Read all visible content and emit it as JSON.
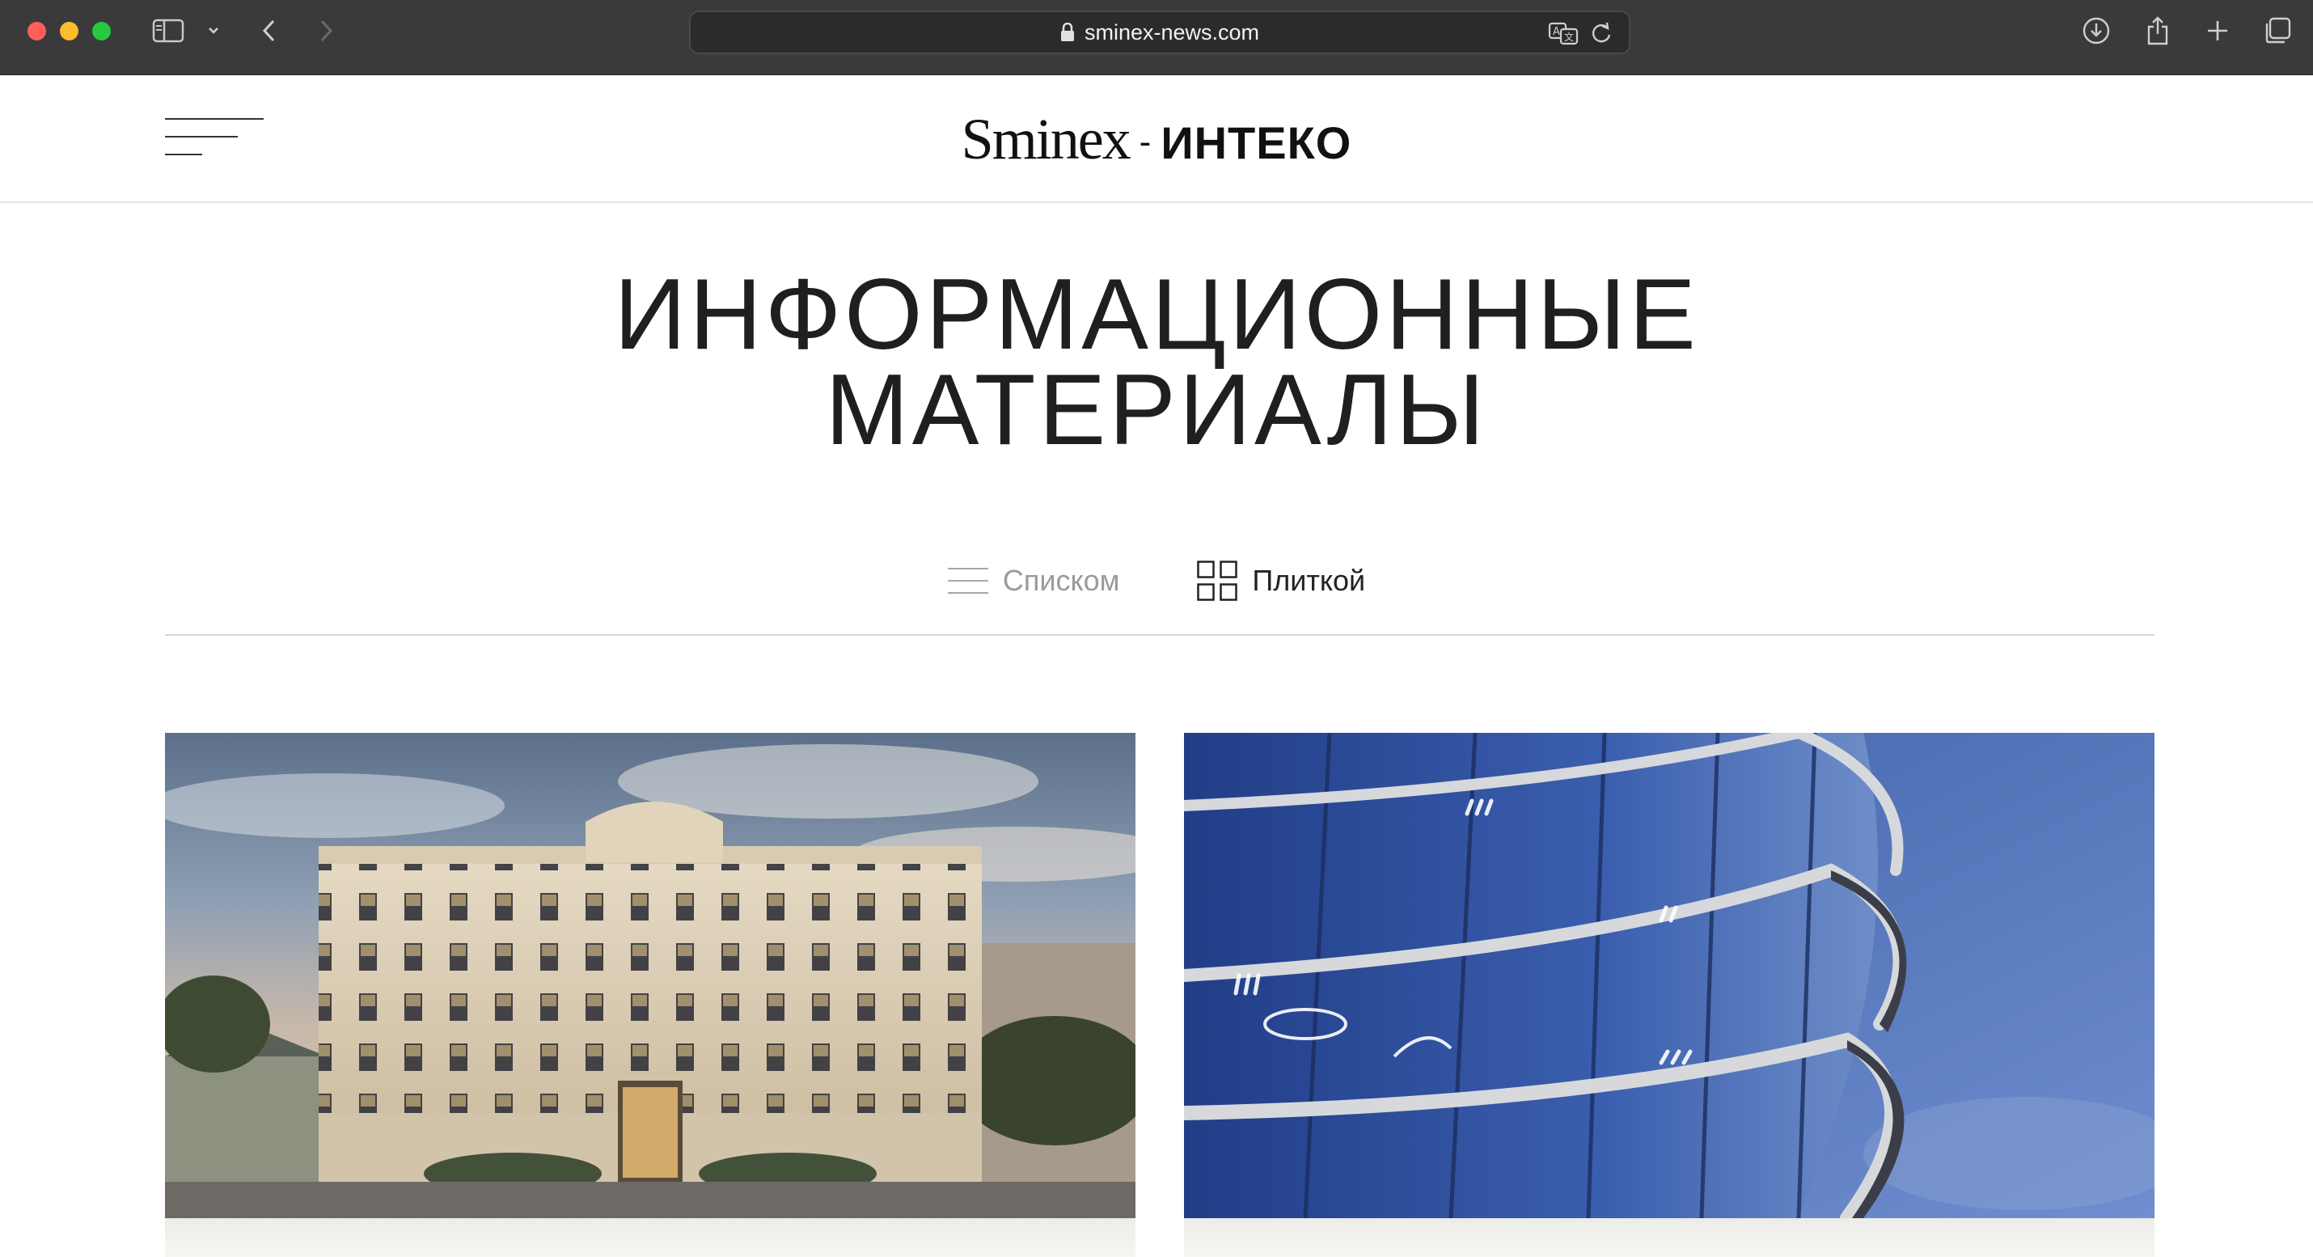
{
  "browser": {
    "url": "sminex-news.com",
    "icons": [
      "sidebar-icon",
      "chevron-down-icon",
      "back-icon",
      "forward-icon",
      "lock-icon",
      "translate-icon",
      "reload-icon",
      "download-icon",
      "share-icon",
      "new-tab-icon",
      "tabs-overview-icon"
    ]
  },
  "header": {
    "logo_primary": "Sminex",
    "logo_separator": "-",
    "logo_secondary": "ИНТЕКО"
  },
  "page": {
    "title_line1": "ИНФОРМАЦИОННЫЕ",
    "title_line2": "МАТЕРИАЛЫ"
  },
  "view_toggle": {
    "list_label": "Списком",
    "tile_label": "Плиткой",
    "active": "tile"
  },
  "cards": [
    {
      "image": "classical-residential-building-at-dusk"
    },
    {
      "image": "curved-glass-skyscraper-facade-at-night"
    }
  ],
  "colors": {
    "chrome_bg": "#3a3a3c",
    "divider": "#d7d9c8",
    "text_dark": "#1f1f1f",
    "text_muted": "#9a9a9a"
  }
}
